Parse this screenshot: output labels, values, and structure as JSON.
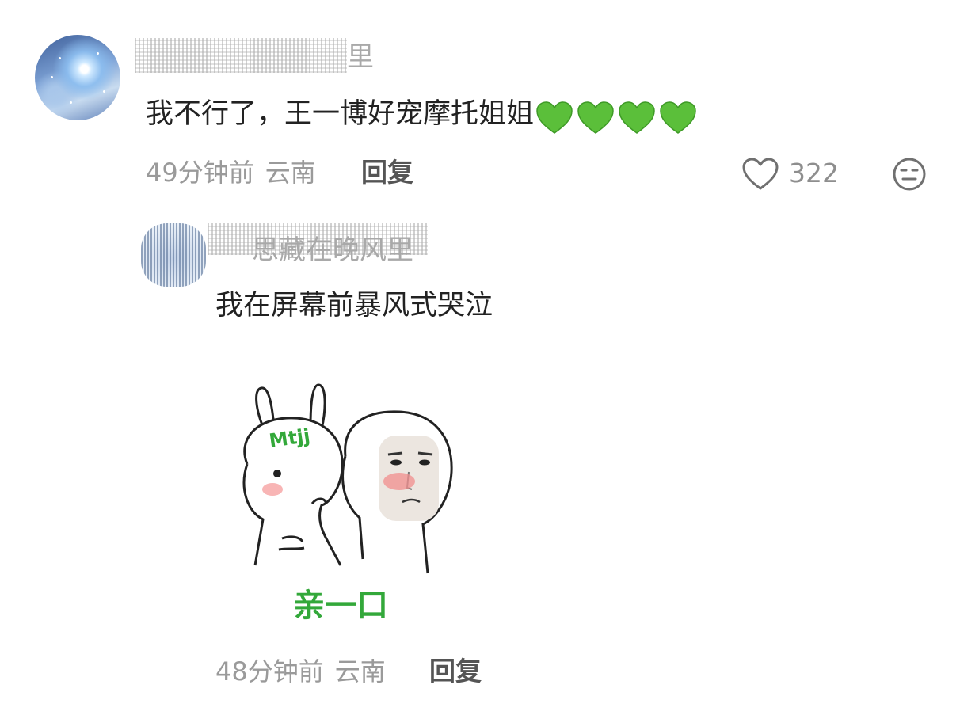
{
  "comments": [
    {
      "username_visible": "里",
      "text": "我不行了，王一博好宠摩托姐姐",
      "hearts": [
        "green-heart-icon",
        "green-heart-icon",
        "green-heart-icon",
        "green-heart-icon"
      ],
      "time": "49分钟前",
      "location": "云南",
      "reply_label": "回复",
      "like_count": "322"
    },
    {
      "username_visible": "思藏在晚风里",
      "text": "我在屏幕前暴风式哭泣",
      "sticker": {
        "hat_text": "Mtjj",
        "caption": "亲一口"
      },
      "time": "48分钟前",
      "location": "云南",
      "reply_label": "回复"
    }
  ],
  "colors": {
    "heart_green": "#5bbf3a",
    "sticker_green": "#33a83a",
    "meta_gray": "#9a9a9a",
    "text_dark": "#222222"
  }
}
